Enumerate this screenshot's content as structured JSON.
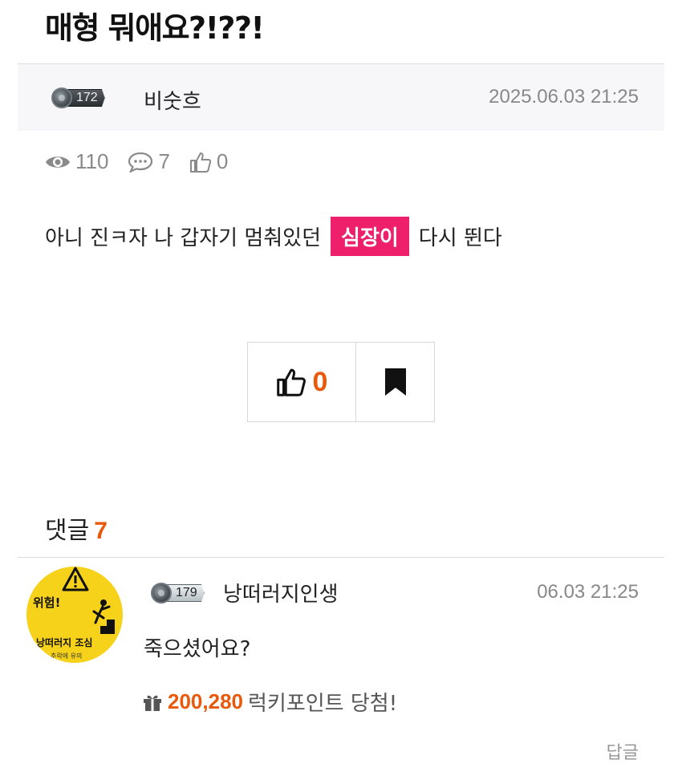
{
  "post": {
    "title": "매형 뭐애요?!??!",
    "author": {
      "level": "172",
      "name": "비숫흐"
    },
    "date": "2025.06.03 21:25",
    "stats": {
      "views": "110",
      "comments": "7",
      "likes": "0"
    },
    "body": {
      "before": "아니 진ㅋ자 나 갑자기 멈춰있던",
      "highlight": "심장이",
      "after": "다시 뛴다"
    },
    "highlight_color": "#ee1f6b"
  },
  "actions": {
    "like_count": "0",
    "accent_color": "#e8590c"
  },
  "comments": {
    "label": "댓글",
    "count": "7",
    "items": [
      {
        "avatar": {
          "title": "위험!",
          "caption": "낭떠러지 조심",
          "subcaption": "추락에 유의"
        },
        "level": "179",
        "author": "낭떠러지인생",
        "date": "06.03 21:25",
        "text": "죽으셨어요?",
        "lucky_points": "200,280",
        "lucky_label": "럭키포인트 당첨!",
        "reply_label": "답글"
      }
    ]
  },
  "icons": [
    "eye-icon",
    "speech-bubble-icon",
    "thumbs-up-icon",
    "bookmark-icon",
    "gift-icon",
    "warning-icon"
  ]
}
